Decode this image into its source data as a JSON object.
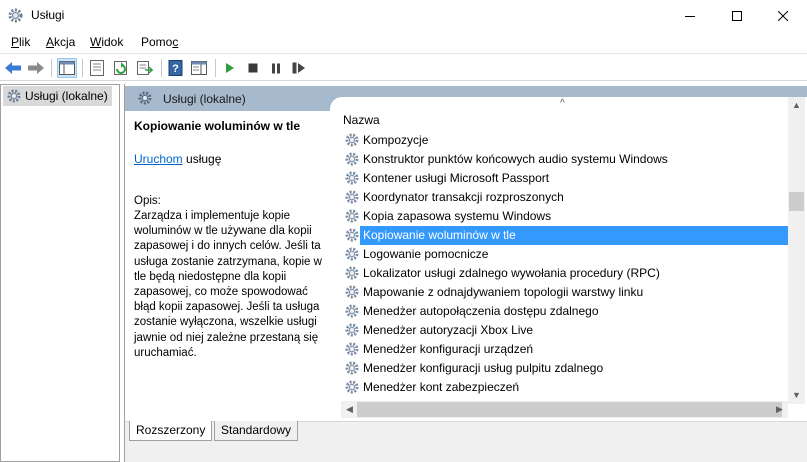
{
  "window": {
    "title": "Usługi",
    "min_glyph": "—",
    "max_glyph": "☐",
    "close_glyph": "✕"
  },
  "menu": {
    "plik_ul": "P",
    "plik_rest": "lik",
    "akcja_ul": "A",
    "akcja_rest": "kcja",
    "widok_ul": "W",
    "widok_rest": "idok",
    "pomoc_pre": "Pomo",
    "pomoc_ul": "c"
  },
  "toolbar_icons": [
    "back-icon",
    "forward-icon",
    "show-hide-tree-icon",
    "properties-icon",
    "refresh-icon",
    "export-list-icon",
    "help-icon",
    "action-pane-icon",
    "start-icon",
    "stop-icon",
    "pause-icon",
    "restart-icon"
  ],
  "tree": {
    "root_label": "Usługi (lokalne)"
  },
  "main": {
    "header_label": "Usługi (lokalne)",
    "selected_service": "Kopiowanie woluminów w tle",
    "start_link": "Uruchom",
    "start_suffix": " usługę",
    "description_heading": "Opis:",
    "description": "Zarządza i implementuje kopie woluminów w tle używane dla kopii zapasowej i do innych celów. Jeśli ta usługa zostanie zatrzymana, kopie w tle będą niedostępne dla kopii zapasowej, co może spowodować błąd kopii zapasowej. Jeśli ta usługa zostanie wyłączona, wszelkie usługi jawnie od niej zależne przestaną się uruchamiać.",
    "column_name": "Nazwa",
    "sort_indicator": "^",
    "services": [
      "Kompozycje",
      "Konstruktor punktów końcowych audio systemu Windows",
      "Kontener usługi Microsoft Passport",
      "Koordynator transakcji rozproszonych",
      "Kopia zapasowa systemu Windows",
      "Kopiowanie woluminów w tle",
      "Logowanie pomocnicze",
      "Lokalizator usługi zdalnego wywołania procedury (RPC)",
      "Mapowanie z odnajdywaniem topologii warstwy linku",
      "Menedżer autopołączenia dostępu zdalnego",
      "Menedżer autoryzacji Xbox Live",
      "Menedżer konfiguracji urządzeń",
      "Menedżer konfiguracji usług pulpitu zdalnego",
      "Menedżer kont zabezpieczeń"
    ],
    "selected_index": 5
  },
  "tabs": {
    "extended": "Rozszerzony",
    "standard": "Standardowy"
  },
  "colors": {
    "selection": "#3399ff",
    "header": "#a6b9cd",
    "link": "#0066cc"
  }
}
